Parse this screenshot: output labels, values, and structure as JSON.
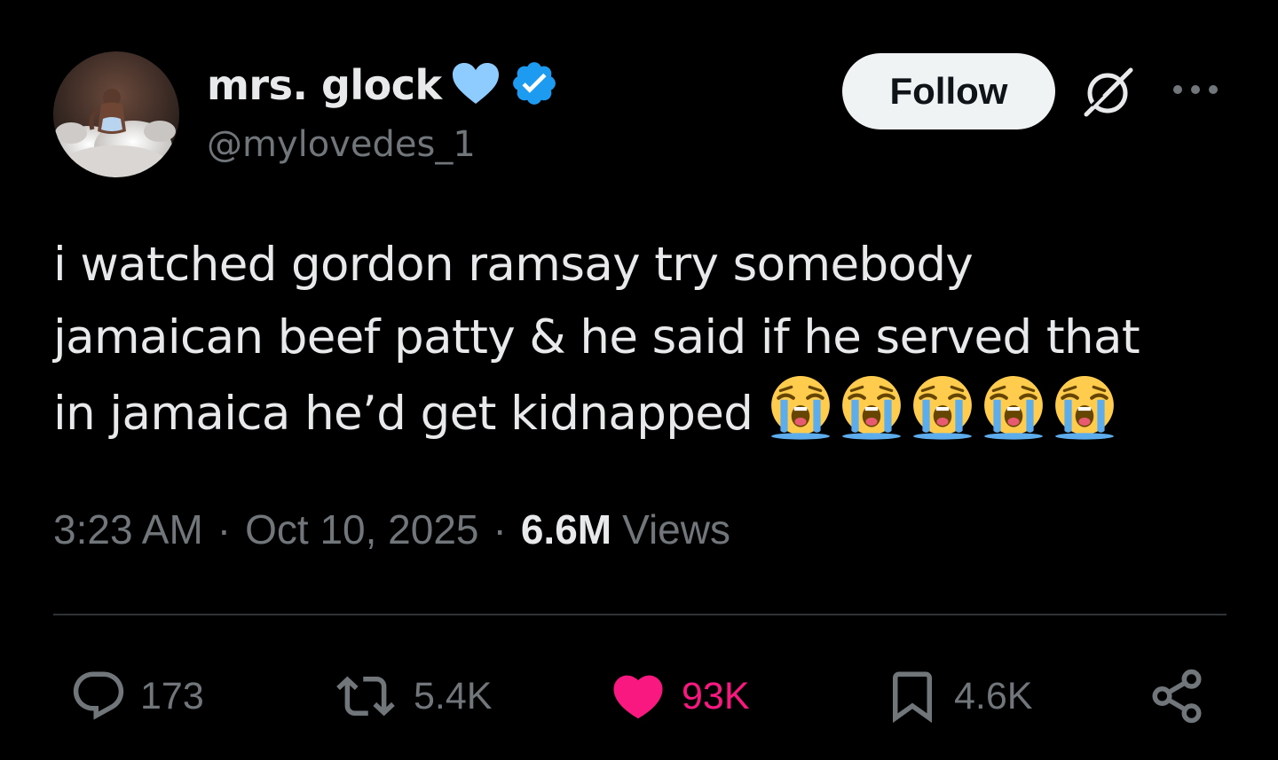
{
  "author": {
    "display_name": "mrs. glock",
    "handle": "@mylovedes_1",
    "heart_badge_color": "#8ecbff",
    "verified_badge_color": "#1d9bf0"
  },
  "header": {
    "follow_label": "Follow",
    "grok_icon": "grok-icon",
    "more_icon": "more-icon"
  },
  "tweet": {
    "lines": [
      "i watched gordon ramsay try somebody",
      "jamaican beef patty & he said if he served that",
      "in jamaica he’d get kidnapped"
    ],
    "emoji": [
      "loudly-crying-face",
      "loudly-crying-face",
      "loudly-crying-face",
      "loudly-crying-face",
      "loudly-crying-face"
    ]
  },
  "meta": {
    "time": "3:23 AM",
    "date": "Oct 10, 2025",
    "separator": "·",
    "views_count": "6.6M",
    "views_label": "Views"
  },
  "actions": {
    "replies": "173",
    "reposts": "5.4K",
    "likes": "93K",
    "bookmarks": "4.6K",
    "like_color": "#f91880",
    "muted_color": "#71767b"
  }
}
